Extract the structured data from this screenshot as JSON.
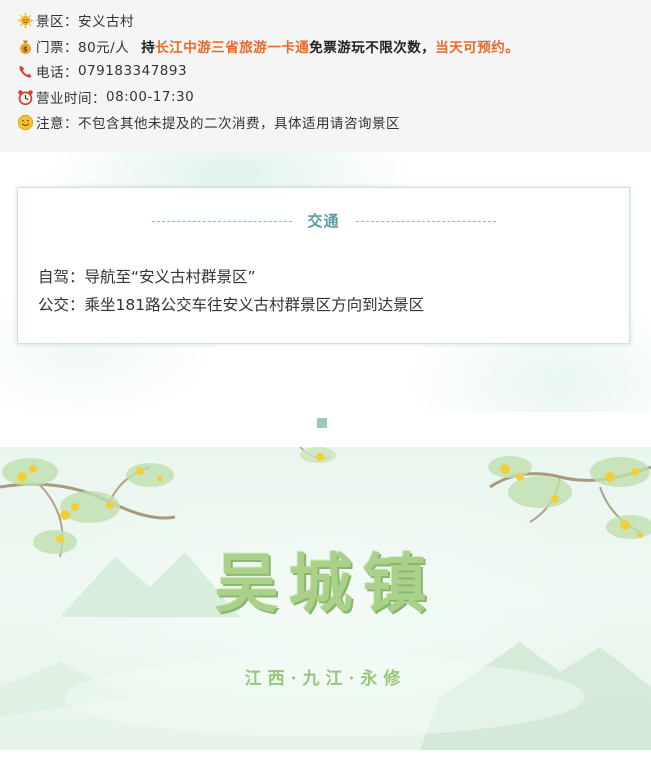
{
  "info": {
    "scenic": {
      "label": "景区：",
      "value": "安义古村",
      "icon": "sun-face-icon"
    },
    "ticket": {
      "label": "门票：",
      "price": "80元/人",
      "hold": "持",
      "card_name": "长江中游三省旅游一卡通",
      "free_text": "免票游玩不限次数，",
      "reserve": "当天可预约。",
      "icon": "money-bag-icon"
    },
    "phone": {
      "label": "电话：",
      "value": "079183347893",
      "icon": "telephone-icon"
    },
    "hours": {
      "label": "营业时间：",
      "value": "08:00-17:30",
      "icon": "alarm-clock-icon"
    },
    "note": {
      "label": "注意：",
      "value": "不包含其他未提及的二次消费，具体适用请咨询景区",
      "icon": "smile-face-icon"
    }
  },
  "transport": {
    "title": "交通",
    "self_drive": "自驾：导航至“安义古村群景区”",
    "bus": "公交：乘坐181路公交车往安义古村群景区方向到达景区"
  },
  "banner": {
    "title": "吴城镇",
    "subtitle": "江西·九江·永修"
  },
  "colors": {
    "accent_orange": "#e8692a",
    "title_teal": "#5d9ea0",
    "banner_green": "#a9d18a",
    "info_bg": "#f5f5f5"
  }
}
